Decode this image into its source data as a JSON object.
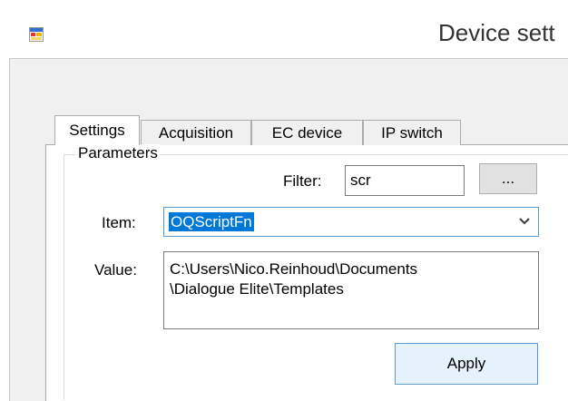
{
  "window": {
    "title": "Device sett",
    "icon": "app-window-icon"
  },
  "tabs": [
    {
      "label": "Settings",
      "active": true
    },
    {
      "label": "Acquisition",
      "active": false
    },
    {
      "label": "EC device",
      "active": false
    },
    {
      "label": "IP switch",
      "active": false
    }
  ],
  "parameters": {
    "group_label": "Parameters",
    "filter_label": "Filter:",
    "filter_value": "scr",
    "browse_label": "...",
    "item_label": "Item:",
    "item_value": "OQScriptFn",
    "item_dropdown_icon": "chevron-down-icon",
    "value_label": "Value:",
    "value_lines": [
      "C:\\Users\\Nico.Reinhoud\\Documents",
      "\\Dialogue Elite\\Templates"
    ],
    "apply_label": "Apply"
  },
  "colors": {
    "selection": "#0078d7",
    "focus_border": "#5b9bd5",
    "panel_bg": "#f0f0f0"
  }
}
